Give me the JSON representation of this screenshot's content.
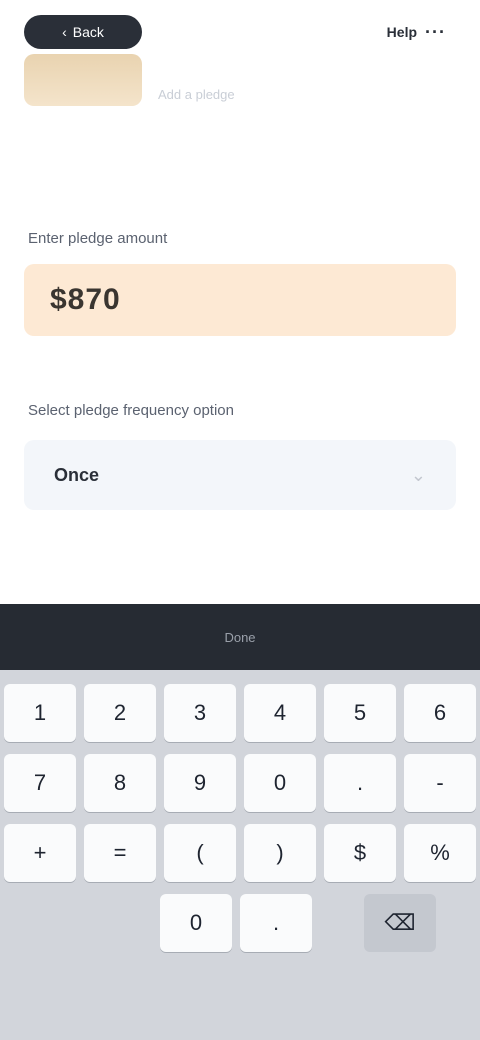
{
  "top_bar": {
    "back_label": "Back",
    "action_label": "Help",
    "action_dots": "···"
  },
  "header": {
    "subtitle": "Add a pledge"
  },
  "form": {
    "amount_label": "Enter pledge amount",
    "amount_value": "$870",
    "frequency_label": "Select pledge frequency option",
    "frequency_value": "Once"
  },
  "keyboard": {
    "toolbar_label": "Done",
    "rows": [
      [
        "1",
        "2",
        "3",
        "4",
        "5",
        "6"
      ],
      [
        "7",
        "8",
        "9",
        "0",
        ".",
        "-"
      ],
      [
        "+",
        "=",
        "(",
        ")",
        "$",
        "%"
      ]
    ],
    "bottom": [
      "0",
      ".",
      "⌫"
    ]
  }
}
